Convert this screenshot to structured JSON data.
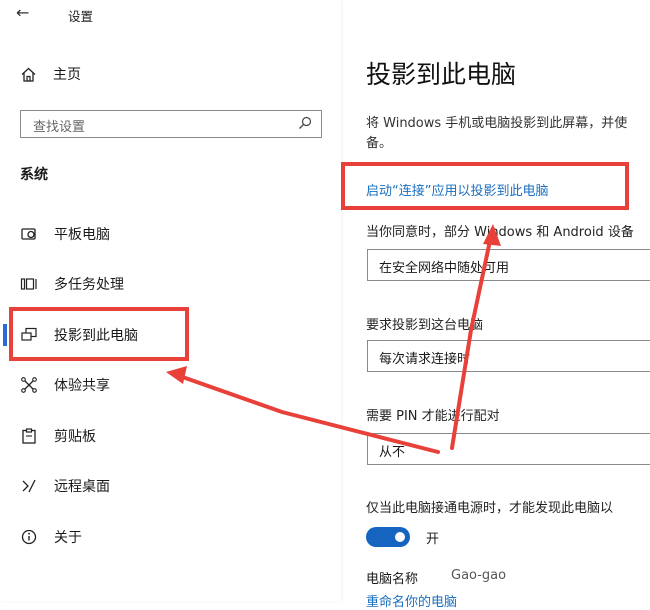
{
  "window": {
    "back_icon": "back-arrow-icon",
    "title": "设置"
  },
  "sidebar": {
    "home_label": "主页",
    "search_placeholder": "查找设置",
    "section_title": "系统",
    "items": [
      {
        "label": "平板电脑",
        "icon": "tablet-icon"
      },
      {
        "label": "多任务处理",
        "icon": "multitask-icon"
      },
      {
        "label": "投影到此电脑",
        "icon": "project-icon",
        "selected": true
      },
      {
        "label": "体验共享",
        "icon": "share-icon"
      },
      {
        "label": "剪贴板",
        "icon": "clipboard-icon"
      },
      {
        "label": "远程桌面",
        "icon": "remote-desktop-icon"
      },
      {
        "label": "关于",
        "icon": "info-icon"
      }
    ]
  },
  "main": {
    "title": "投影到此电脑",
    "description_line1": "将 Windows 手机或电脑投影到此屏幕，并使",
    "description_line2": "备。",
    "link": "启动“连接”应用以投影到此电脑",
    "setting1_label": "当你同意时，部分 Windows 和 Android 设备",
    "setting1_value": "在安全网络中随处可用",
    "setting2_label": "要求投影到这台电脑",
    "setting2_value": "每次请求连接时",
    "setting3_label": "需要 PIN 才能进行配对",
    "setting3_value": "从不",
    "power_label": "仅当此电脑接通电源时，才能发现此电脑以",
    "toggle_state": "开",
    "pc_name_label": "电脑名称",
    "pc_name_value": "Gao-gao",
    "rename_link": "重命名你的电脑"
  },
  "annotation_color": "#e8413a",
  "accent": "#1565c0"
}
